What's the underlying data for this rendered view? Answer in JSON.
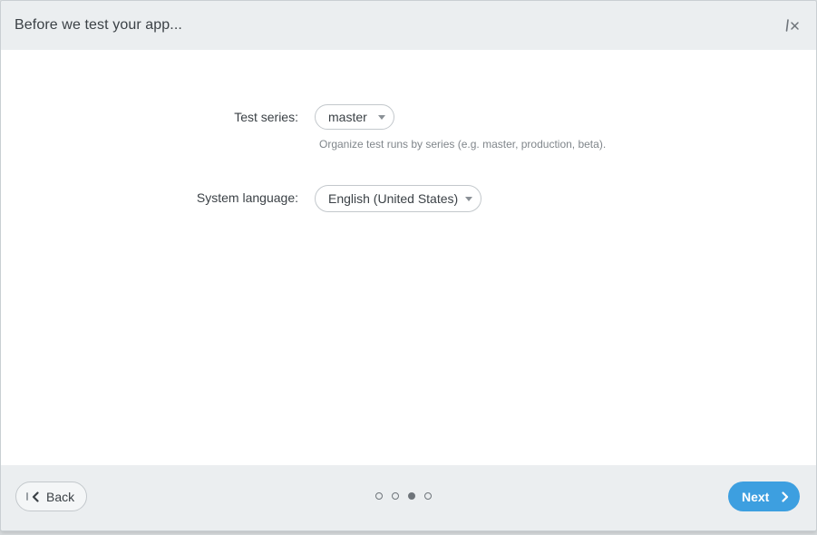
{
  "header": {
    "title": "Before we test your app..."
  },
  "form": {
    "test_series": {
      "label": "Test series:",
      "value": "master",
      "hint": "Organize test runs by series (e.g. master, production, beta)."
    },
    "system_language": {
      "label": "System language:",
      "value": "English (United States)"
    }
  },
  "footer": {
    "back_label": "Back",
    "next_label": "Next",
    "steps": [
      {
        "active": false
      },
      {
        "active": false
      },
      {
        "active": true
      },
      {
        "active": false
      }
    ],
    "current_step": 3,
    "total_steps": 4
  },
  "colors": {
    "accent": "#3d9fe0",
    "header_bg": "#ebeef0",
    "text": "#3b4146",
    "hint_text": "#80868b"
  }
}
